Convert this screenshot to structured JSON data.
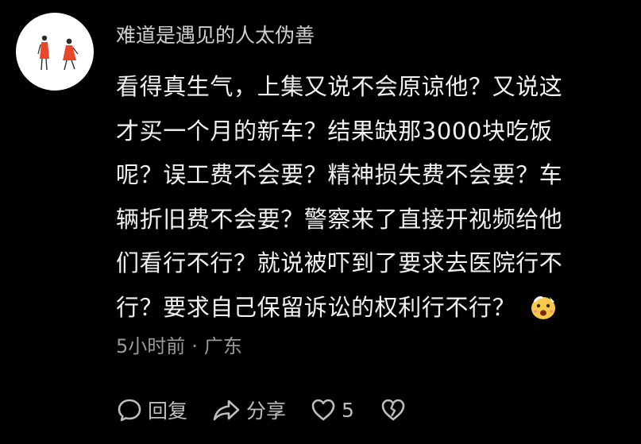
{
  "comment": {
    "username": "难道是遇见的人太伪善",
    "lines": [
      "看得真生气，上集又说不会原谅他？又说这",
      "才买一个月的新车？结果缺那3000块吃饭",
      "呢？误工费不会要？精神损失费不会要？车",
      "辆折旧费不会要？警察来了直接开视频给他",
      "们看行不行？就说被吓到了要求去医院行不",
      "行？要求自己保留诉讼的权利行不行？"
    ],
    "time": "5小时前",
    "separator": "·",
    "location": "广东",
    "inline_emoji_icon": "shocked-face-emoji"
  },
  "actions": {
    "reply_label": "回复",
    "share_label": "分享",
    "like_count": "5",
    "reply_icon": "speech-bubble-icon",
    "share_icon": "share-arrow-icon",
    "like_icon": "heart-icon",
    "dislike_icon": "broken-heart-icon"
  },
  "colors": {
    "background": "#000000",
    "text": "#f2f2f2",
    "username": "#cfcfcf",
    "meta": "#9a9a9a",
    "action": "#bdbdbd",
    "avatar_figure": "#e8472a"
  }
}
